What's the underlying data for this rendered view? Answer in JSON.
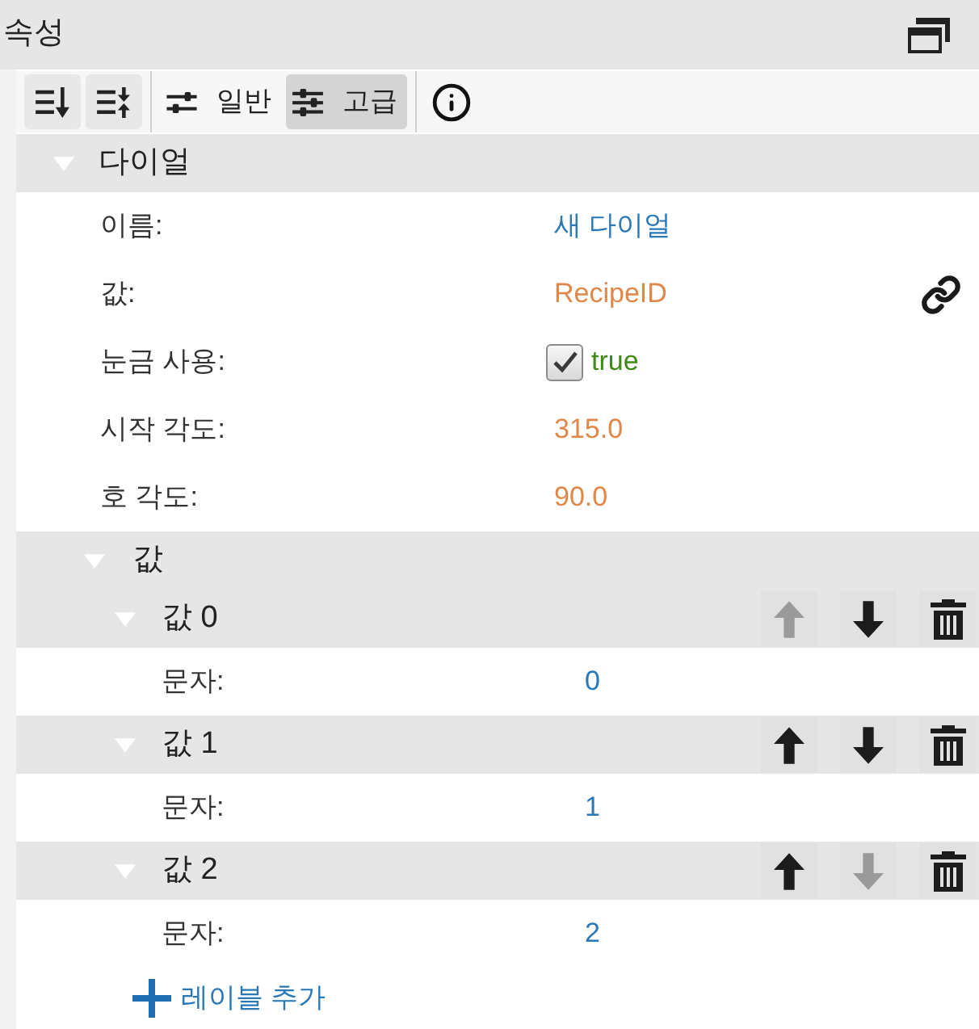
{
  "panel": {
    "title": "속성"
  },
  "toolbar": {
    "view_tabs": [
      {
        "kind": "basic",
        "label": "일반",
        "selected": false
      },
      {
        "kind": "advanced",
        "label": "고급",
        "selected": true
      }
    ]
  },
  "section": {
    "title": "다이얼",
    "expanded": true,
    "properties": [
      {
        "label": "이름:",
        "kind": "text",
        "value": "새 다이얼"
      },
      {
        "label": "값:",
        "kind": "binding",
        "value": "RecipeID"
      },
      {
        "label": "눈금 사용:",
        "kind": "boolean",
        "value": "true",
        "checked": true
      },
      {
        "label": "시작 각도:",
        "kind": "number",
        "value": "315.0"
      },
      {
        "label": "호 각도:",
        "kind": "number",
        "value": "90.0"
      }
    ]
  },
  "values_group": {
    "title": "값",
    "expanded": true,
    "items": [
      {
        "title": "값 0",
        "expanded": true,
        "up_disabled": true,
        "down_disabled": false,
        "properties": [
          {
            "label": "문자:",
            "kind": "text",
            "value": "0"
          }
        ]
      },
      {
        "title": "값 1",
        "expanded": true,
        "up_disabled": false,
        "down_disabled": false,
        "properties": [
          {
            "label": "문자:",
            "kind": "text",
            "value": "1"
          }
        ]
      },
      {
        "title": "값 2",
        "expanded": true,
        "up_disabled": false,
        "down_disabled": true,
        "properties": [
          {
            "label": "문자:",
            "kind": "text",
            "value": "2"
          }
        ]
      }
    ]
  },
  "add_button": {
    "label": "레이블 추가"
  }
}
